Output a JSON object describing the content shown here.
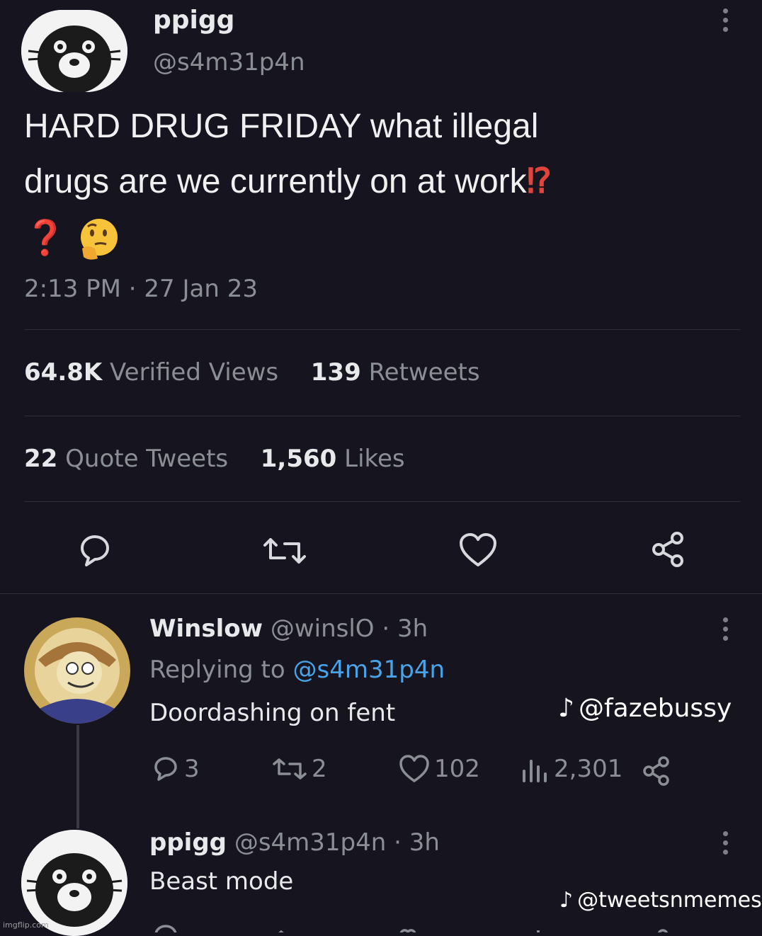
{
  "tweet": {
    "author_name": "ppigg",
    "author_handle": "@s4m31p4n",
    "text_line1": "HARD DRUG FRIDAY what illegal",
    "text_line2": "drugs are we currently on at work",
    "text_emoji_exq": "⁉",
    "text_emoji_line": "❓",
    "timestamp": "2:13 PM · 27 Jan 23",
    "stats": {
      "views_num": "64.8K",
      "views_label": "Verified Views",
      "retweets_num": "139",
      "retweets_label": "Retweets",
      "quotes_num": "22",
      "quotes_label": "Quote Tweets",
      "likes_num": "1,560",
      "likes_label": "Likes"
    },
    "actions": [
      "reply-icon",
      "retweet-icon",
      "like-icon",
      "share-icon"
    ]
  },
  "reply1": {
    "author_name": "Winslow",
    "author_handle": "@winslO · 3h",
    "replying_prefix": "Replying to",
    "replying_handle": "@s4m31p4n",
    "text": "Doordashing on fent",
    "counts": {
      "replies": "3",
      "retweets": "2",
      "likes": "102",
      "views": "2,301"
    }
  },
  "reply2": {
    "author_name": "ppigg",
    "author_handle": "@s4m31p4n · 3h",
    "text": "Beast mode"
  },
  "watermarks": {
    "tiktok_1": "@fazebussy",
    "tiktok_2": "@tweetsnmemes",
    "imgflip": "imgflip.com"
  },
  "colors": {
    "background": "#16151f",
    "link": "#4aa3e8",
    "muted": "#8b8f95",
    "accent_red": "#e0443b"
  }
}
